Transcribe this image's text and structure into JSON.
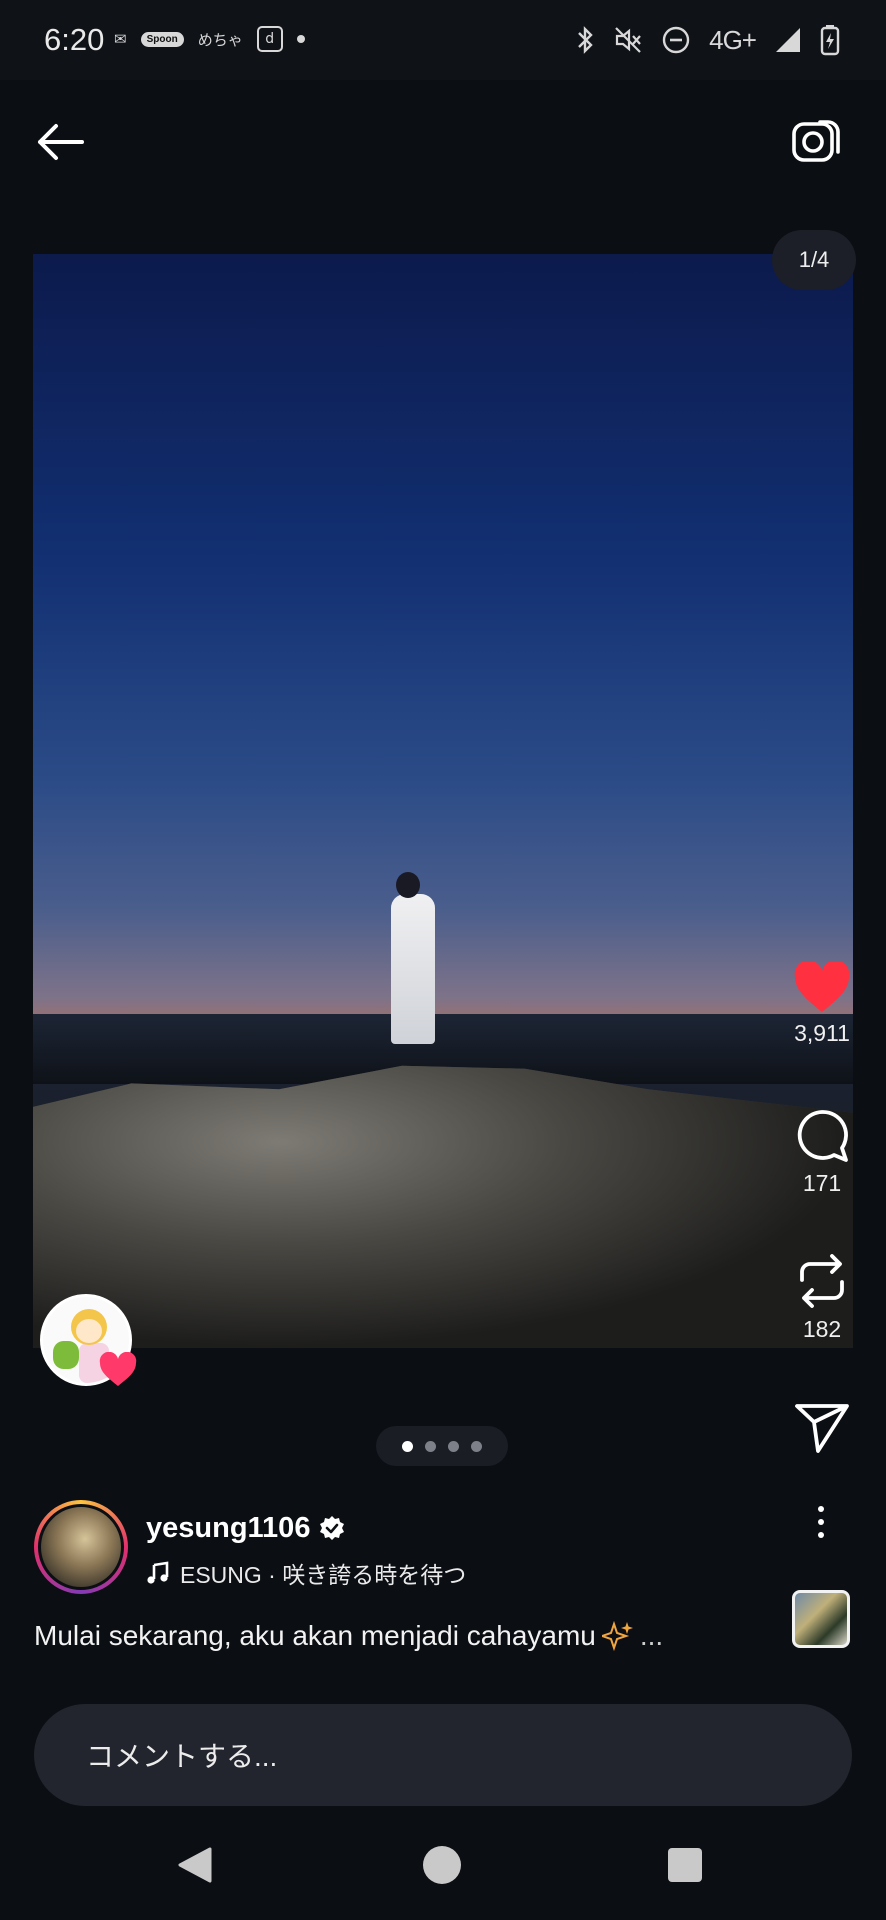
{
  "status_bar": {
    "time": "6:20",
    "left_icons": [
      "mail-icon",
      "spoon-app-icon",
      "mecha-app-icon",
      "d-app-icon",
      "dot-icon"
    ],
    "spoon_label": "Spoon",
    "mecha_label": "めちゃ",
    "d_label": "d",
    "network": "4G+",
    "right_icons": [
      "bluetooth-icon",
      "mute-icon",
      "dnd-icon",
      "signal-icon",
      "battery-icon"
    ]
  },
  "header": {
    "back_icon": "arrow-left-icon",
    "camera_icon": "camera-icon"
  },
  "post": {
    "image_counter": "1/4",
    "current_image": 1,
    "total_images": 4,
    "liked": true
  },
  "actions": {
    "likes": "3,911",
    "comments": "171",
    "reposts": "182",
    "like_color": "#ff3040"
  },
  "author": {
    "username": "yesung1106",
    "verified": true,
    "music": "ESUNG · 咲き誇る時を待つ"
  },
  "caption": {
    "text": "Mulai sekarang, aku akan menjadi cahayamu",
    "emoji": "✨",
    "more": "..."
  },
  "comment": {
    "placeholder": "コメントする..."
  }
}
